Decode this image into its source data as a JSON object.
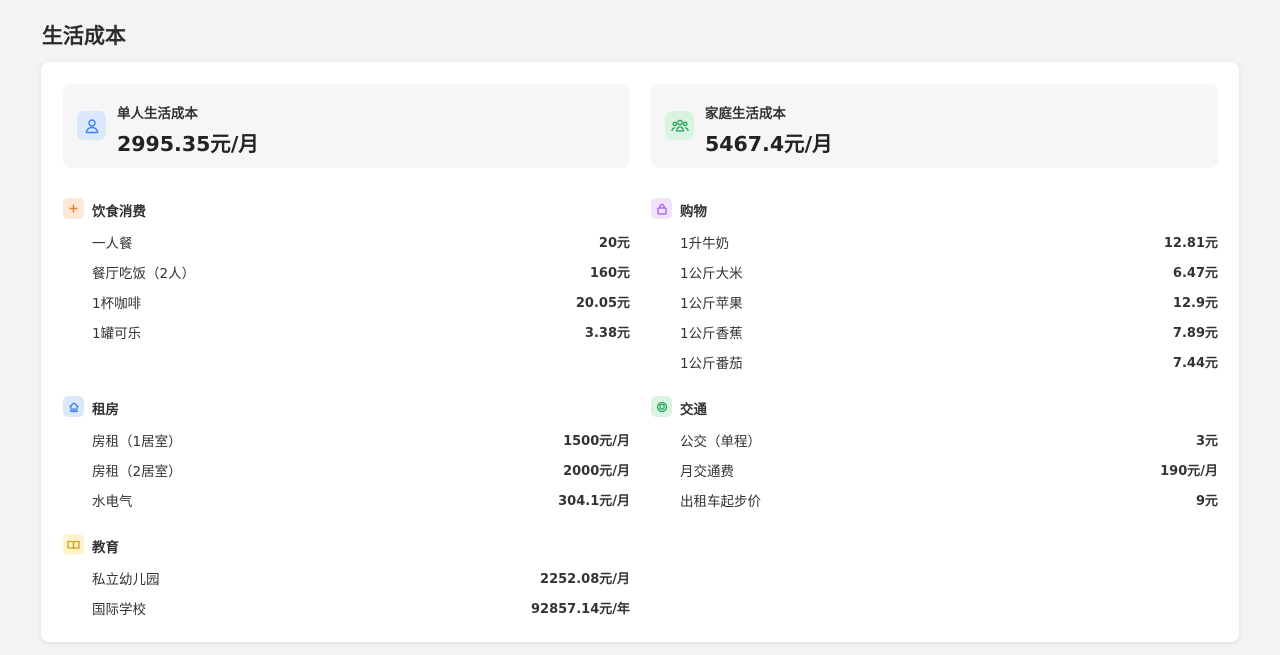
{
  "page_title": "生活成本",
  "summaries": [
    {
      "label": "单人生活成本",
      "value": "2995.35元/月",
      "icon": "user-icon",
      "color": "#3b82f6",
      "bg": "#dbe8fb"
    },
    {
      "label": "家庭生活成本",
      "value": "5467.4元/月",
      "icon": "family-icon",
      "color": "#22a559",
      "bg": "#daf3e3"
    }
  ],
  "sections": {
    "food": {
      "title": "饮食消费",
      "icon": "plus-icon",
      "color": "#ea7a3a",
      "bg": "#fde8d8",
      "items": [
        {
          "name": "一人餐",
          "value": "20元"
        },
        {
          "name": "餐厅吃饭（2人）",
          "value": "160元"
        },
        {
          "name": "1杯咖啡",
          "value": "20.05元"
        },
        {
          "name": "1罐可乐",
          "value": "3.38元"
        }
      ]
    },
    "shopping": {
      "title": "购物",
      "icon": "shopping-bag-icon",
      "color": "#a855f7",
      "bg": "#f1e3fd",
      "items": [
        {
          "name": "1升牛奶",
          "value": "12.81元"
        },
        {
          "name": "1公斤大米",
          "value": "6.47元"
        },
        {
          "name": "1公斤苹果",
          "value": "12.9元"
        },
        {
          "name": "1公斤香蕉",
          "value": "7.89元"
        },
        {
          "name": "1公斤番茄",
          "value": "7.44元"
        }
      ]
    },
    "rent": {
      "title": "租房",
      "icon": "home-icon",
      "color": "#3b82f6",
      "bg": "#dbe8fb",
      "items": [
        {
          "name": "房租（1居室）",
          "value": "1500元/月"
        },
        {
          "name": "房租（2居室）",
          "value": "2000元/月"
        },
        {
          "name": "水电气",
          "value": "304.1元/月"
        }
      ]
    },
    "transport": {
      "title": "交通",
      "icon": "transit-icon",
      "color": "#22a559",
      "bg": "#daf3e3",
      "items": [
        {
          "name": "公交（单程）",
          "value": "3元"
        },
        {
          "name": "月交通费",
          "value": "190元/月"
        },
        {
          "name": "出租车起步价",
          "value": "9元"
        }
      ]
    },
    "education": {
      "title": "教育",
      "icon": "book-icon",
      "color": "#d4a017",
      "bg": "#fdf3cc",
      "items": [
        {
          "name": "私立幼儿园",
          "value": "2252.08元/月"
        },
        {
          "name": "国际学校",
          "value": "92857.14元/年"
        }
      ]
    }
  }
}
